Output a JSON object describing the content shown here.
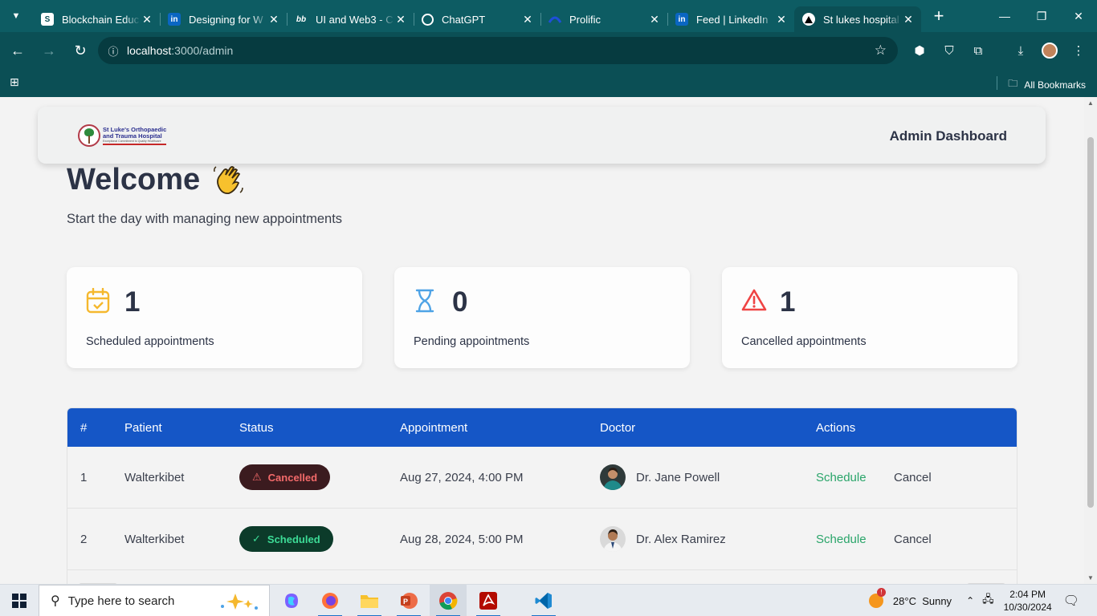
{
  "browser": {
    "tabs": [
      {
        "title": "Blockchain Educ",
        "favicon": "shield-s-icon",
        "active": false
      },
      {
        "title": "Designing for W",
        "favicon": "linkedin-icon",
        "active": false
      },
      {
        "title": "UI and Web3 - C",
        "favicon": "bb-icon",
        "active": false
      },
      {
        "title": "ChatGPT",
        "favicon": "chatgpt-icon",
        "active": false
      },
      {
        "title": "Prolific",
        "favicon": "prolific-icon",
        "active": false
      },
      {
        "title": "Feed | LinkedIn",
        "favicon": "linkedin-icon",
        "active": false
      },
      {
        "title": "St lukes hospital",
        "favicon": "triangle-icon",
        "active": true
      }
    ],
    "url_host": "localhost",
    "url_path": ":3000/admin",
    "bookmarks_label": "All Bookmarks"
  },
  "header": {
    "logo_line1": "St Luke's Orthopaedic",
    "logo_line2": "and Trauma Hospital",
    "logo_tagline": "Exceptional Commitment to Quality Healthcare",
    "title": "Admin Dashboard"
  },
  "welcome": {
    "heading": "Welcome",
    "subtitle": "Start the day with managing new appointments"
  },
  "stats": [
    {
      "count": "1",
      "label": "Scheduled appointments",
      "icon": "calendar-icon",
      "color": "#f5b82e"
    },
    {
      "count": "0",
      "label": "Pending appointments",
      "icon": "hourglass-icon",
      "color": "#4ea3e6"
    },
    {
      "count": "1",
      "label": "Cancelled appointments",
      "icon": "warning-icon",
      "color": "#ef4444"
    }
  ],
  "table": {
    "headers": [
      "#",
      "Patient",
      "Status",
      "Appointment",
      "Doctor",
      "Actions"
    ],
    "rows": [
      {
        "num": "1",
        "patient": "Walterkibet",
        "status": "Cancelled",
        "appointment": "Aug 27, 2024, 4:00 PM",
        "doctor": "Dr. Jane Powell",
        "action_primary": "Schedule",
        "action_secondary": "Cancel"
      },
      {
        "num": "2",
        "patient": "Walterkibet",
        "status": "Scheduled",
        "appointment": "Aug 28, 2024, 5:00 PM",
        "doctor": "Dr. Alex Ramirez",
        "action_primary": "Schedule",
        "action_secondary": "Cancel"
      }
    ]
  },
  "taskbar": {
    "search_placeholder": "Type here to search",
    "weather": "28°C  Sunny",
    "time": "2:04 PM",
    "date": "10/30/2024"
  },
  "colors": {
    "chrome": "#0b4f55",
    "table_header": "#1556c6",
    "cancelled": "#f36a6a",
    "scheduled": "#3ddc97",
    "schedule_link": "#2aa56a"
  }
}
